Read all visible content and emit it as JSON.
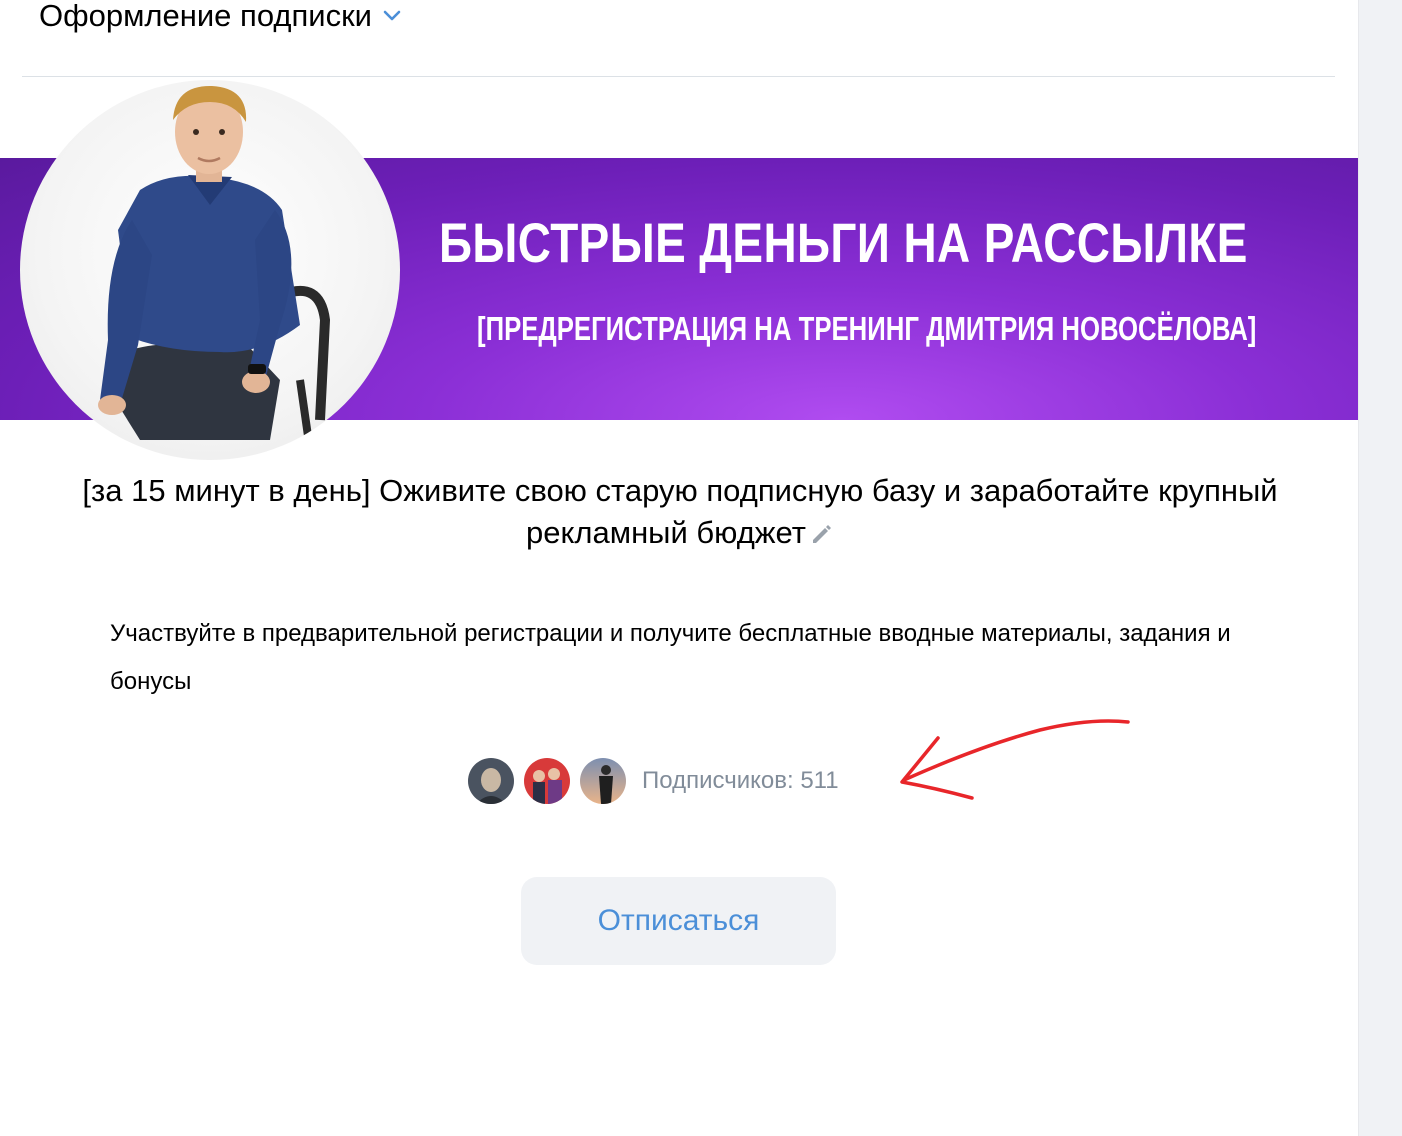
{
  "header": {
    "title": "Оформление подписки",
    "dropdown_icon": "chevron-down-icon"
  },
  "banner": {
    "title": "БЫСТРЫЕ ДЕНЬГИ НА РАССЫЛКЕ",
    "subtitle": "[ПРЕДРЕГИСТРАЦИЯ НА ТРЕНИНГ ДМИТРИЯ НОВОСЁЛОВА]",
    "background_color": "#7a24c8"
  },
  "subscription": {
    "headline": "[за 15 минут в день] Оживите свою старую подписную базу и заработайте крупный рекламный бюджет",
    "edit_icon": "pencil-icon",
    "description": "Участвуйте в предварительной регистрации и получите бесплатные вводные материалы, задания и бонусы",
    "subscribers_text": "Подписчиков: 511",
    "unsubscribe_label": "Отписаться"
  },
  "colors": {
    "accent": "#4b8fd8",
    "secondary_text": "#818c99",
    "annotation_arrow": "#e8262a"
  }
}
